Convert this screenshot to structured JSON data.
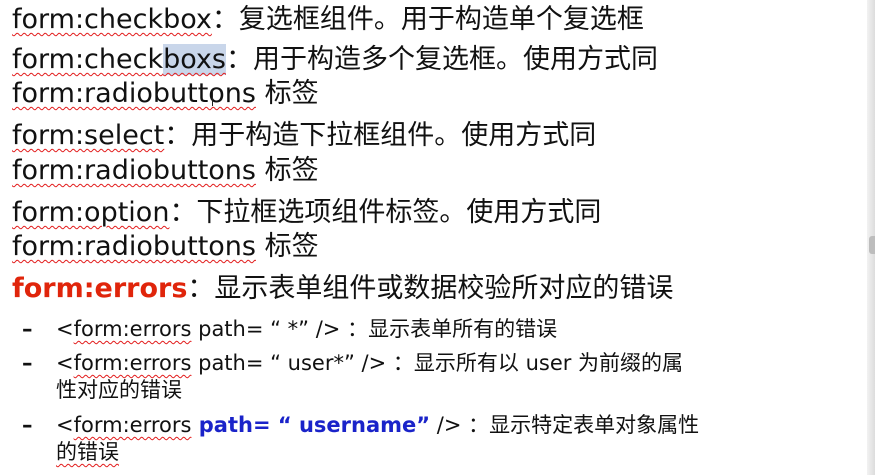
{
  "slide": {
    "items": [
      {
        "tag": "form:checkbox",
        "desc": "：复选框组件。用于构造单个复选框"
      },
      {
        "tag_pre": "form:check",
        "tag_sel": "boxs",
        "desc": "：用于构造多个复选框。使用方式同",
        "cont_tag": "form:radiobuttons",
        "cont_text": " 标签"
      },
      {
        "tag": "form:select",
        "desc": "：用于构造下拉框组件。使用方式同",
        "cont_tag": "form:radiobuttons",
        "cont_text": " 标签"
      },
      {
        "tag": "form:option",
        "desc": "：下拉框选项组件标签。使用方式同",
        "cont_tag": "form:radiobuttons",
        "cont_text": " 标签"
      },
      {
        "tag": "form:errors",
        "desc": "：显示表单组件或数据校验所对应的错误"
      }
    ],
    "subitems": [
      {
        "dash": "–",
        "prefix": "<",
        "tag": "form:errors",
        "attr": " path= “ *” />",
        "desc": " ：显示表单所有的错误"
      },
      {
        "dash": "–",
        "prefix": "<",
        "tag": "form:errors",
        "attr": " path= “ user*” />",
        "desc": " ：显示所有以 user 为前缀的属",
        "cont": "性对应的错误"
      },
      {
        "dash": "–",
        "prefix": "<",
        "tag": "form:errors",
        "attr_bold": " path= “ username”",
        "attr_end": " />",
        "desc": " ：显示特定表单对象属性",
        "cont": "的错误"
      }
    ]
  }
}
